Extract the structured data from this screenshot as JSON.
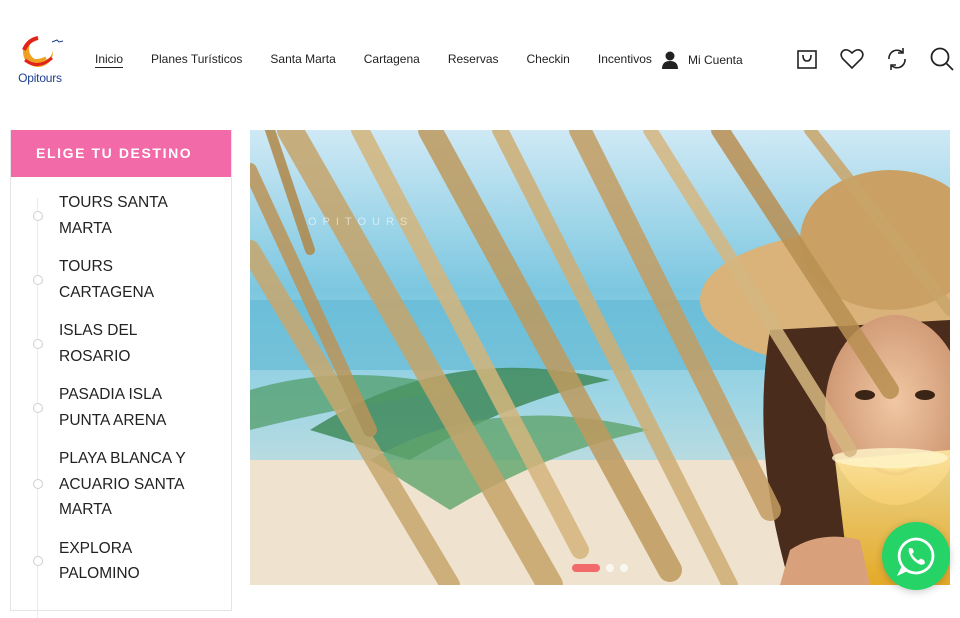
{
  "brand": {
    "name": "Opitours",
    "accent": "#f26aa8",
    "whatsapp_color": "#25d366"
  },
  "nav": {
    "items": [
      "Inicio",
      "Planes Turísticos",
      "Santa Marta",
      "Cartagena",
      "Reservas",
      "Checkin",
      "Incentivos"
    ],
    "active": "Inicio",
    "account_label": "Mi Cuenta"
  },
  "header_icons": [
    "cart-icon",
    "heart-icon",
    "compare-icon",
    "search-icon"
  ],
  "sidebar": {
    "title": "ELIGE TU DESTINO",
    "items": [
      "TOURS SANTA MARTA",
      "TOURS CARTAGENA",
      "ISLAS DEL ROSARIO",
      "PASADIA ISLA PUNTA ARENA",
      "PLAYA BLANCA Y ACUARIO SANTA MARTA",
      "EXPLORA PALOMINO"
    ]
  },
  "hero": {
    "watermark": "OPITOURS",
    "slides": 3,
    "active_slide": 1
  }
}
